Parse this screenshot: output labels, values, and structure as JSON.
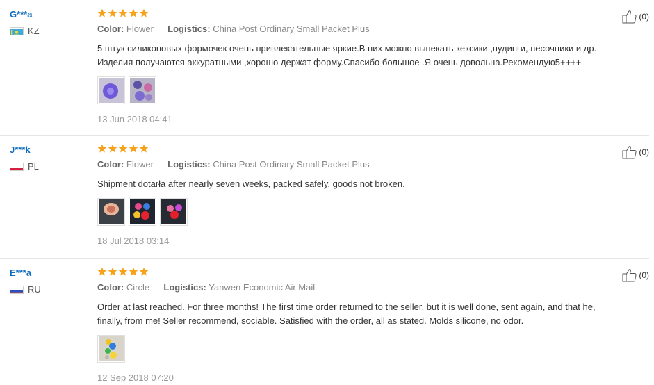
{
  "reviews": [
    {
      "user": "G***a",
      "country_code": "KZ",
      "rating": 5,
      "color_label": "Color:",
      "color_value": "Flower",
      "logistics_label": "Logistics:",
      "logistics_value": "China Post Ordinary Small Packet Plus",
      "text": "5 штук силиконовых формочек очень привлекательные яркие.В них можно выпекать кексики ,пудинги, песочники и др. Изделия получаются аккуратными ,хорошо держат форму.Спасибо большое .Я очень довольна.Рекомендую5++++",
      "photo_count": 2,
      "date": "13 Jun 2018 04:41",
      "helpful_count": "(0)"
    },
    {
      "user": "J***k",
      "country_code": "PL",
      "rating": 5,
      "color_label": "Color:",
      "color_value": "Flower",
      "logistics_label": "Logistics:",
      "logistics_value": "China Post Ordinary Small Packet Plus",
      "text": "Shipment dotarła after nearly seven weeks, packed safely, goods not broken.",
      "photo_count": 3,
      "date": "18 Jul 2018 03:14",
      "helpful_count": "(0)"
    },
    {
      "user": "E***a",
      "country_code": "RU",
      "rating": 5,
      "color_label": "Color:",
      "color_value": "Circle",
      "logistics_label": "Logistics:",
      "logistics_value": "Yanwen Economic Air Mail",
      "text": "Order at last reached. For three months! The first time order returned to the seller, but it is well done, sent again, and that he, finally, from me! Seller recommend, sociable. Satisfied with the order, all as stated. Molds silicone, no odor.",
      "photo_count": 1,
      "date": "12 Sep 2018 07:20",
      "helpful_count": "(0)"
    }
  ],
  "colors": {
    "star": "#f7a21b",
    "username": "#0b6bbf",
    "divider": "#e6e6e6"
  },
  "icons": {
    "star": "star-icon",
    "helpful": "thumbs-up-icon",
    "flag_kz": "flag-kz-icon",
    "flag_pl": "flag-pl-icon",
    "flag_ru": "flag-ru-icon"
  }
}
